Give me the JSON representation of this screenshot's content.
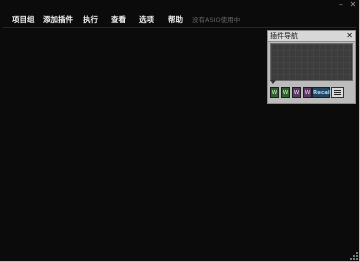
{
  "window": {
    "minimize_glyph": "–",
    "close_glyph": "✕"
  },
  "menu": {
    "items": [
      {
        "label": "项目组"
      },
      {
        "label": "添加插件"
      },
      {
        "label": "执行"
      },
      {
        "label": "查看"
      },
      {
        "label": "选项"
      },
      {
        "label": "帮助"
      }
    ],
    "status": "没有ASIO使用中"
  },
  "plugin_navigator": {
    "title": "插件导航",
    "close_glyph": "✕",
    "toolbar": {
      "buttons": [
        {
          "label": "W"
        },
        {
          "label": "W"
        },
        {
          "label": "W"
        },
        {
          "label": "W"
        },
        {
          "label": "Recall"
        }
      ],
      "menu_icon": "menu-icon"
    }
  },
  "colors": {
    "background": "#0b0b0b",
    "menu_text": "#f2f2f2",
    "status_text": "#666666",
    "panel": "#bcbcbc"
  }
}
